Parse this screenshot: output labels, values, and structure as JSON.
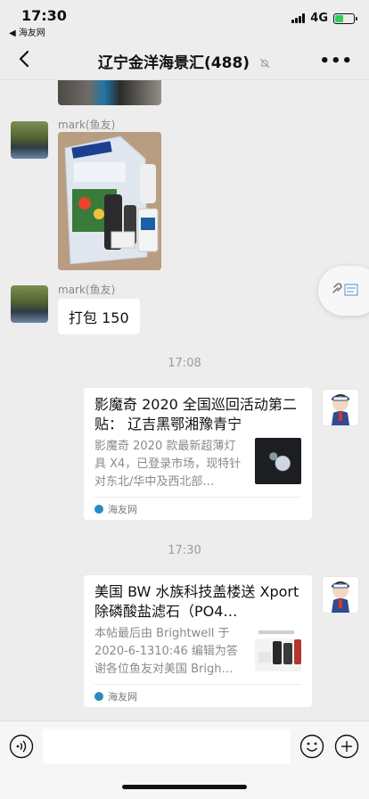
{
  "status": {
    "time": "17:30",
    "back_app": "◀ 海友网",
    "network": "4G",
    "battery_level": 0.45
  },
  "nav": {
    "title": "辽宁金洋海景汇(488)"
  },
  "messages": {
    "sender1": "mark(鱼友)",
    "sender2": "mark(鱼友)",
    "text1": "打包 150",
    "time1": "17:08",
    "time2": "17:30"
  },
  "cards": [
    {
      "title": "影魔奇 2020 全国巡回活动第二贴： 辽吉黑鄂湘豫青宁",
      "desc": "影魔奇 2020 款最新超薄灯具 X4，已登录市场，现特针对东北/华中及西北部…",
      "source": "海友网"
    },
    {
      "title": "美国 BW 水族科技盖楼送 Xport 除磷酸盐滤石（PO4…",
      "desc": "本帖最后由 Brightwell 于 2020-6-1310:46 编辑为答谢各位鱼友对美国 Brigh…",
      "source": "海友网"
    }
  ],
  "colors": {
    "chat_bg": "#ededed",
    "bubble_bg": "#ffffff",
    "accent_blue": "#2a8bbf"
  }
}
